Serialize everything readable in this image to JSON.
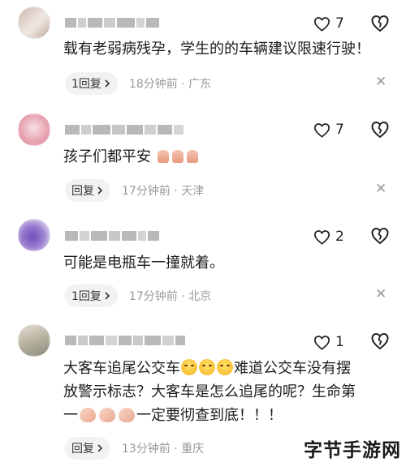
{
  "comments": [
    {
      "likes": "7",
      "text": "载有老弱病残孕，学生的的车辆建议限速行驶！",
      "reply_label": "1回复",
      "time": "18分钟前",
      "location": "广东",
      "avatar_colors": [
        "#c9b6ad",
        "#e7dcd6"
      ]
    },
    {
      "likes": "7",
      "text": "孩子们都平安",
      "reply_label": "回复",
      "time": "17分钟前",
      "location": "天津",
      "avatar_colors": [
        "#e8a3b1",
        "#f4d3da"
      ]
    },
    {
      "likes": "2",
      "text": "可能是电瓶车一撞就着。",
      "reply_label": "1回复",
      "time": "17分钟前",
      "location": "北京",
      "avatar_colors": [
        "#9a7fd1",
        "#d8cdef"
      ]
    },
    {
      "likes": "1",
      "text_line1_a": "大客车追尾公交车",
      "text_line1_b": "难道公交车没有摆",
      "text_line2": "放警示标志？大客车是怎么追尾的呢？生命第",
      "text_line3_a": "一",
      "text_line3_b": "一定要彻查到底！！！",
      "reply_label": "回复",
      "time": "13分钟前",
      "location": "重庆",
      "avatar_colors": [
        "#b7b29f",
        "#e2ded3"
      ]
    }
  ],
  "separator": "·",
  "watermark": "字节手游网",
  "icons": {
    "like": "heart-outline-icon",
    "dislike": "broken-heart-icon",
    "close": "close-icon",
    "chevron": "chevron-right-icon"
  }
}
